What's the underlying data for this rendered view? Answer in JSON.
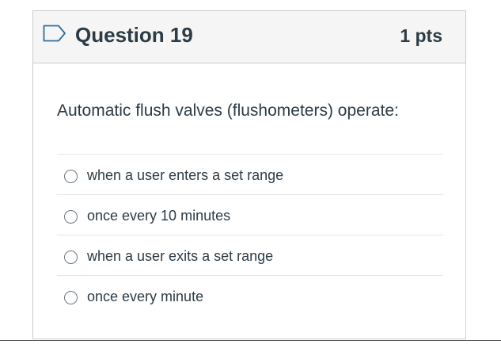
{
  "question": {
    "title": "Question 19",
    "points": "1 pts",
    "text": "Automatic flush valves (flushometers) operate:",
    "icon": "flag-icon"
  },
  "answers": [
    {
      "label": "when a user enters a set range"
    },
    {
      "label": "once every 10 minutes"
    },
    {
      "label": "when a user exits a set range"
    },
    {
      "label": "once every minute"
    }
  ],
  "colors": {
    "text": "#2d3b45",
    "header_bg": "#f5f5f5",
    "border": "#c7cdd1",
    "flag": "#2d6ea3"
  }
}
